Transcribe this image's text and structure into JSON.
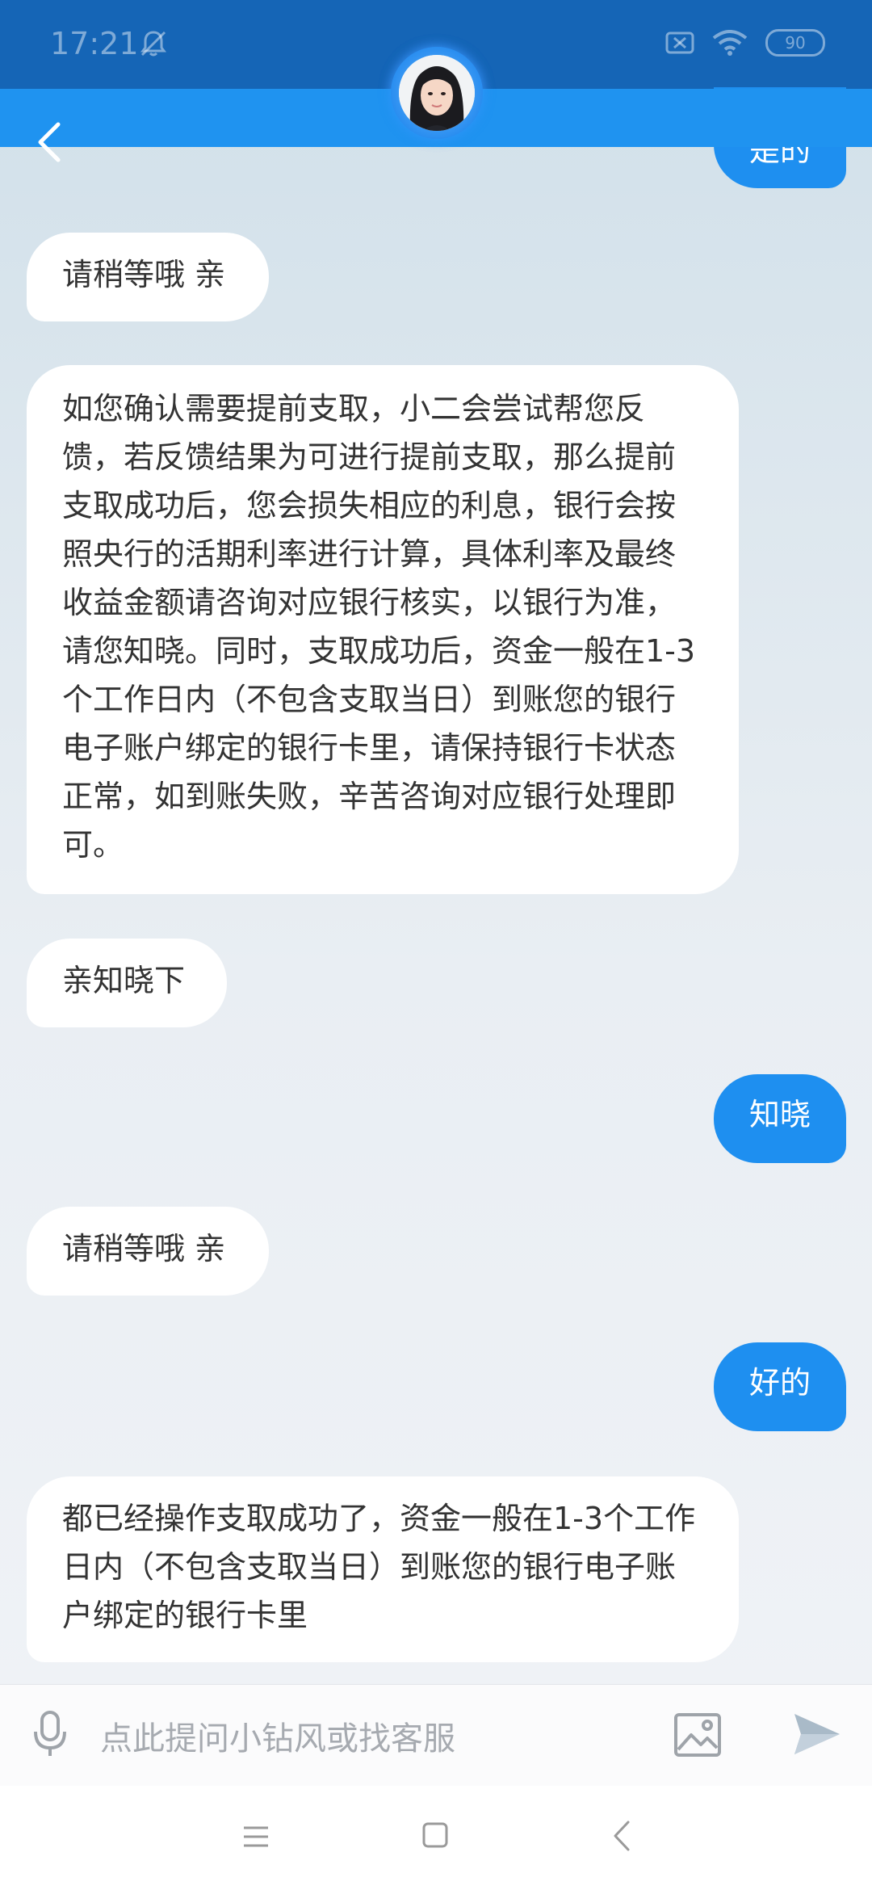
{
  "status_bar": {
    "time": "17:21",
    "battery": "90"
  },
  "chat": {
    "partial_top_reply": "是的",
    "messages": [
      {
        "side": "left",
        "text": "请稍等哦 亲"
      },
      {
        "side": "left",
        "text": "如您确认需要提前支取，小二会尝试帮您反馈，若反馈结果为可进行提前支取，那么提前支取成功后，您会损失相应的利息，银行会按照央行的活期利率进行计算，具体利率及最终收益金额请咨询对应银行核实，以银行为准，请您知晓。同时，支取成功后，资金一般在1-3个工作日内（不包含支取当日）到账您的银行电子账户绑定的银行卡里，请保持银行卡状态正常，如到账失败，辛苦咨询对应银行处理即可。"
      },
      {
        "side": "left",
        "text": "亲知晓下"
      },
      {
        "side": "right",
        "text": "知晓"
      },
      {
        "side": "left",
        "text": "请稍等哦 亲"
      },
      {
        "side": "right",
        "text": "好的"
      },
      {
        "side": "left",
        "text": "都已经操作支取成功了，资金一般在1-3个工作日内（不包含支取当日）到账您的银行电子账户绑定的银行卡里"
      }
    ]
  },
  "input": {
    "placeholder": "点此提问小钻风或找客服"
  },
  "colors": {
    "accent": "#1e8ff0",
    "header": "#1565b6",
    "nav": "#1f93f0"
  }
}
